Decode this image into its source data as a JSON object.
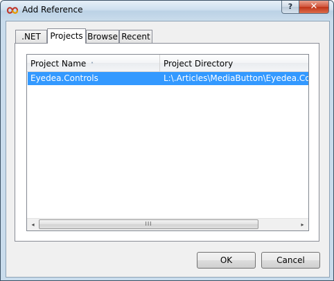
{
  "window": {
    "title": "Add Reference",
    "help_label": "?",
    "close_label": "✕"
  },
  "tabs": [
    {
      "label": ".NET",
      "active": false
    },
    {
      "label": "Projects",
      "active": true
    },
    {
      "label": "Browse",
      "active": false
    },
    {
      "label": "Recent",
      "active": false
    }
  ],
  "list": {
    "columns": [
      "Project Name",
      "Project Directory"
    ],
    "sort_indicator": "˄",
    "rows": [
      {
        "name": "Eyedea.Controls",
        "directory": "L:\\.Articles\\MediaButton\\Eyedea.Controls",
        "selected": true
      }
    ]
  },
  "scrollbar": {
    "left_arrow": "◂",
    "right_arrow": "▸",
    "thumb_grip": "III"
  },
  "buttons": {
    "ok": "OK",
    "cancel": "Cancel"
  },
  "colors": {
    "selection": "#3399ff",
    "title_bar": "#c8dbeb",
    "close_button": "#c8412a"
  }
}
